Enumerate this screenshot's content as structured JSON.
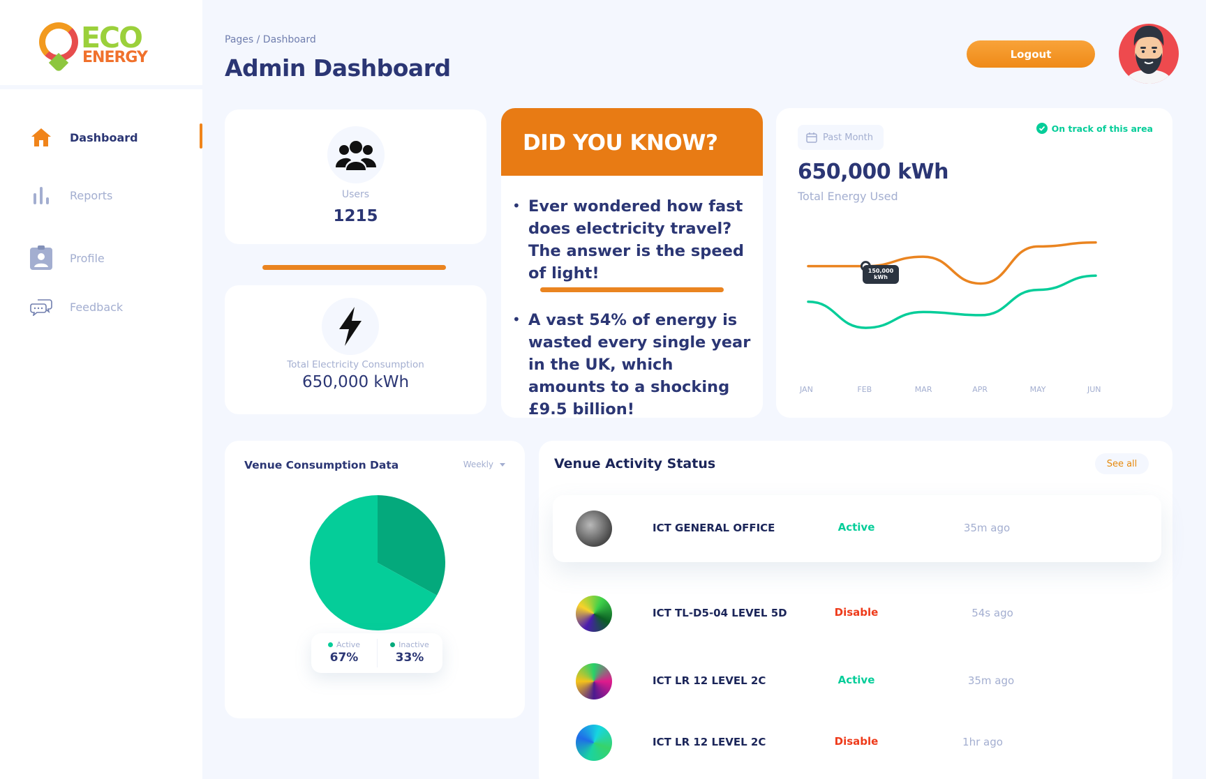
{
  "brand": {
    "line1": "ECO",
    "line2": "ENERGY"
  },
  "sidebar": {
    "items": [
      {
        "label": "Dashboard",
        "icon": "home-icon",
        "active": true
      },
      {
        "label": "Reports",
        "icon": "bar-chart-icon",
        "active": false
      },
      {
        "label": "Profile",
        "icon": "id-badge-icon",
        "active": false
      },
      {
        "label": "Feedback",
        "icon": "chat-bubbles-icon",
        "active": false
      }
    ]
  },
  "header": {
    "breadcrumb": "Pages / Dashboard",
    "title": "Admin Dashboard",
    "logout_label": "Logout"
  },
  "users_card": {
    "label": "Users",
    "value": "1215",
    "icon": "users-icon"
  },
  "consumption_card": {
    "label": "Total Electricity Consumption",
    "value": "650,000 kWh",
    "icon": "lightning-icon"
  },
  "did_you_know": {
    "title": "DID YOU KNOW?",
    "facts": [
      "Ever wondered how fast does electricity travel? The answer is the speed of light!",
      "A vast 54% of energy is wasted every single year in the UK, which amounts to a shocking £9.5 billion!"
    ]
  },
  "energy_card": {
    "period": "Past Month",
    "status": "On track of this area",
    "value": "650,000 kWh",
    "label": "Total Energy Used",
    "tooltip_line1": "150,000",
    "tooltip_line2": "kWh"
  },
  "venue_consumption": {
    "title": "Venue Consumption Data",
    "range": "Weekly",
    "legend": [
      {
        "label": "Active",
        "value": "67%",
        "color": "#05cd99"
      },
      {
        "label": "Inactive",
        "value": "33%",
        "color": "#04a97c"
      }
    ]
  },
  "venue_activity": {
    "title": "Venue Activity Status",
    "see_all": "See all",
    "rows": [
      {
        "name": "ICT GENERAL OFFICE",
        "status": "Active",
        "time": "35m ago"
      },
      {
        "name": "ICT TL-D5-04 LEVEL 5D",
        "status": "Disable",
        "time": "54s ago"
      },
      {
        "name": "ICT LR 12 LEVEL 2C",
        "status": "Active",
        "time": "35m ago"
      },
      {
        "name": "ICT LR 12 LEVEL 2C",
        "status": "Disable",
        "time": "1hr ago"
      }
    ]
  },
  "colors": {
    "accent": "#f0841a",
    "navy": "#2b3674",
    "active": "#05cd99",
    "disable": "#ee3a1a"
  },
  "chart_data": [
    {
      "type": "line",
      "categories": [
        "JAN",
        "FEB",
        "MAR",
        "APR",
        "MAY",
        "JUN"
      ],
      "series": [
        {
          "values": [
            150000,
            150000,
            162000,
            128000,
            175000,
            180000
          ],
          "color": "#ea8420"
        },
        {
          "values": [
            105000,
            72000,
            92000,
            88000,
            120000,
            138000
          ],
          "color": "#05cd99"
        }
      ],
      "ylabel": "",
      "grid": false
    },
    {
      "type": "pie",
      "labels": [
        "Active",
        "Inactive"
      ],
      "values": [
        67,
        33
      ],
      "colors": [
        "#05cd99",
        "#04a97c"
      ]
    }
  ]
}
